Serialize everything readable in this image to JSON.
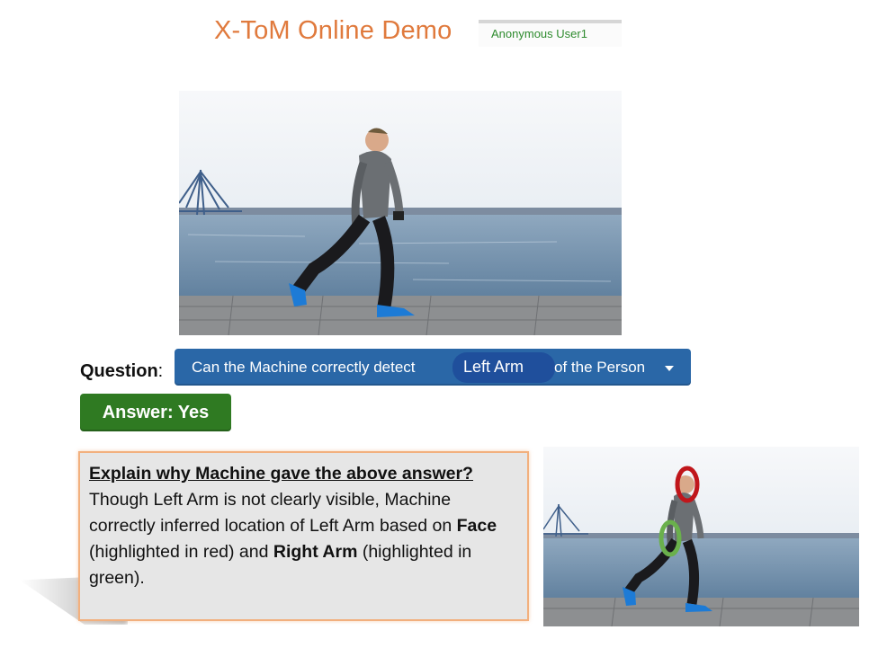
{
  "header": {
    "title": "X-ToM Online Demo",
    "user": "Anonymous User1"
  },
  "question": {
    "label": "Question",
    "colon": ":",
    "prefix": "Can the Machine correctly detect",
    "selected_part": "Left Arm",
    "suffix": "of the Person"
  },
  "answer": {
    "label": "Answer: Yes"
  },
  "explanation": {
    "heading": "Explain why Machine gave the above answer?",
    "text_1": "Though Left Arm is not clearly visible, Machine correctly inferred location of Left Arm based on ",
    "face_term": "Face",
    "text_2": " (highlighted in red) and ",
    "arm_term": "Right Arm",
    "text_3": " (highlighted in green)."
  },
  "colors": {
    "title": "#e07a3d",
    "question_bar": "#2a67a7",
    "answer_button": "#2f7a22",
    "highlight_face": "#c0161b",
    "highlight_arm": "#6ab04c",
    "explain_border": "#f2b07e"
  }
}
